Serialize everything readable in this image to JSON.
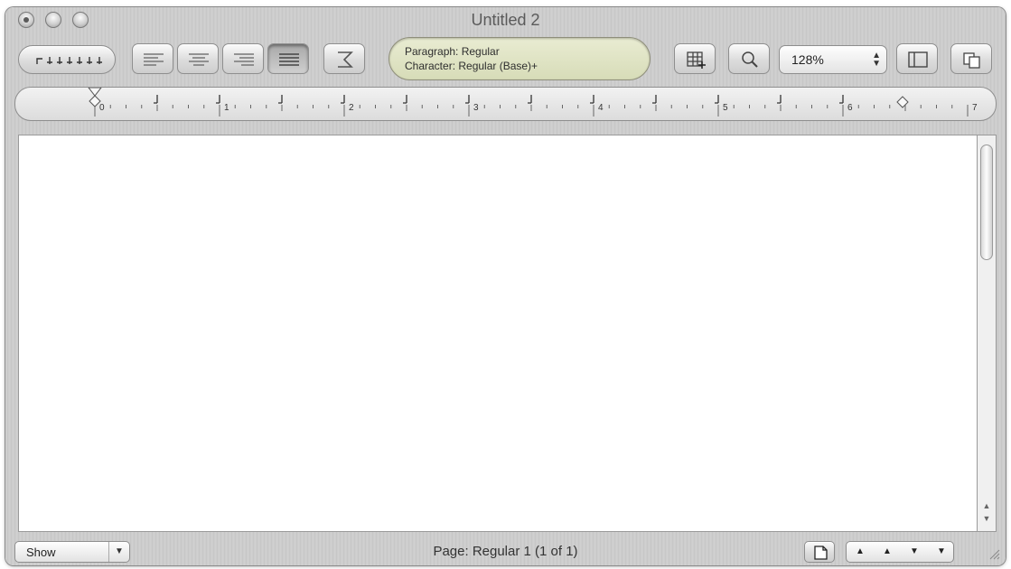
{
  "window": {
    "title": "Untitled 2"
  },
  "toolbar": {
    "paragraph_line": "Paragraph: Regular",
    "character_line": "Character: Regular (Base)+",
    "zoom_value": "128%"
  },
  "ruler": {
    "labels": [
      "0",
      "1",
      "2",
      "3",
      "4",
      "5",
      "6",
      "7"
    ]
  },
  "bottom_bar": {
    "show_label": "Show",
    "page_status": "Page: Regular 1 (1 of 1)"
  },
  "icons": [
    "window-close-icon",
    "window-minimize-icon",
    "window-zoom-icon",
    "tab-stops-icon",
    "align-left-icon",
    "align-center-icon",
    "align-right-icon",
    "justify-icon",
    "invisibles-icon",
    "table-icon",
    "search-icon",
    "sidebar-icon",
    "page-layout-icon",
    "first-page-icon",
    "previous-page-icon",
    "next-page-icon",
    "last-page-icon",
    "resize-grip-icon"
  ]
}
